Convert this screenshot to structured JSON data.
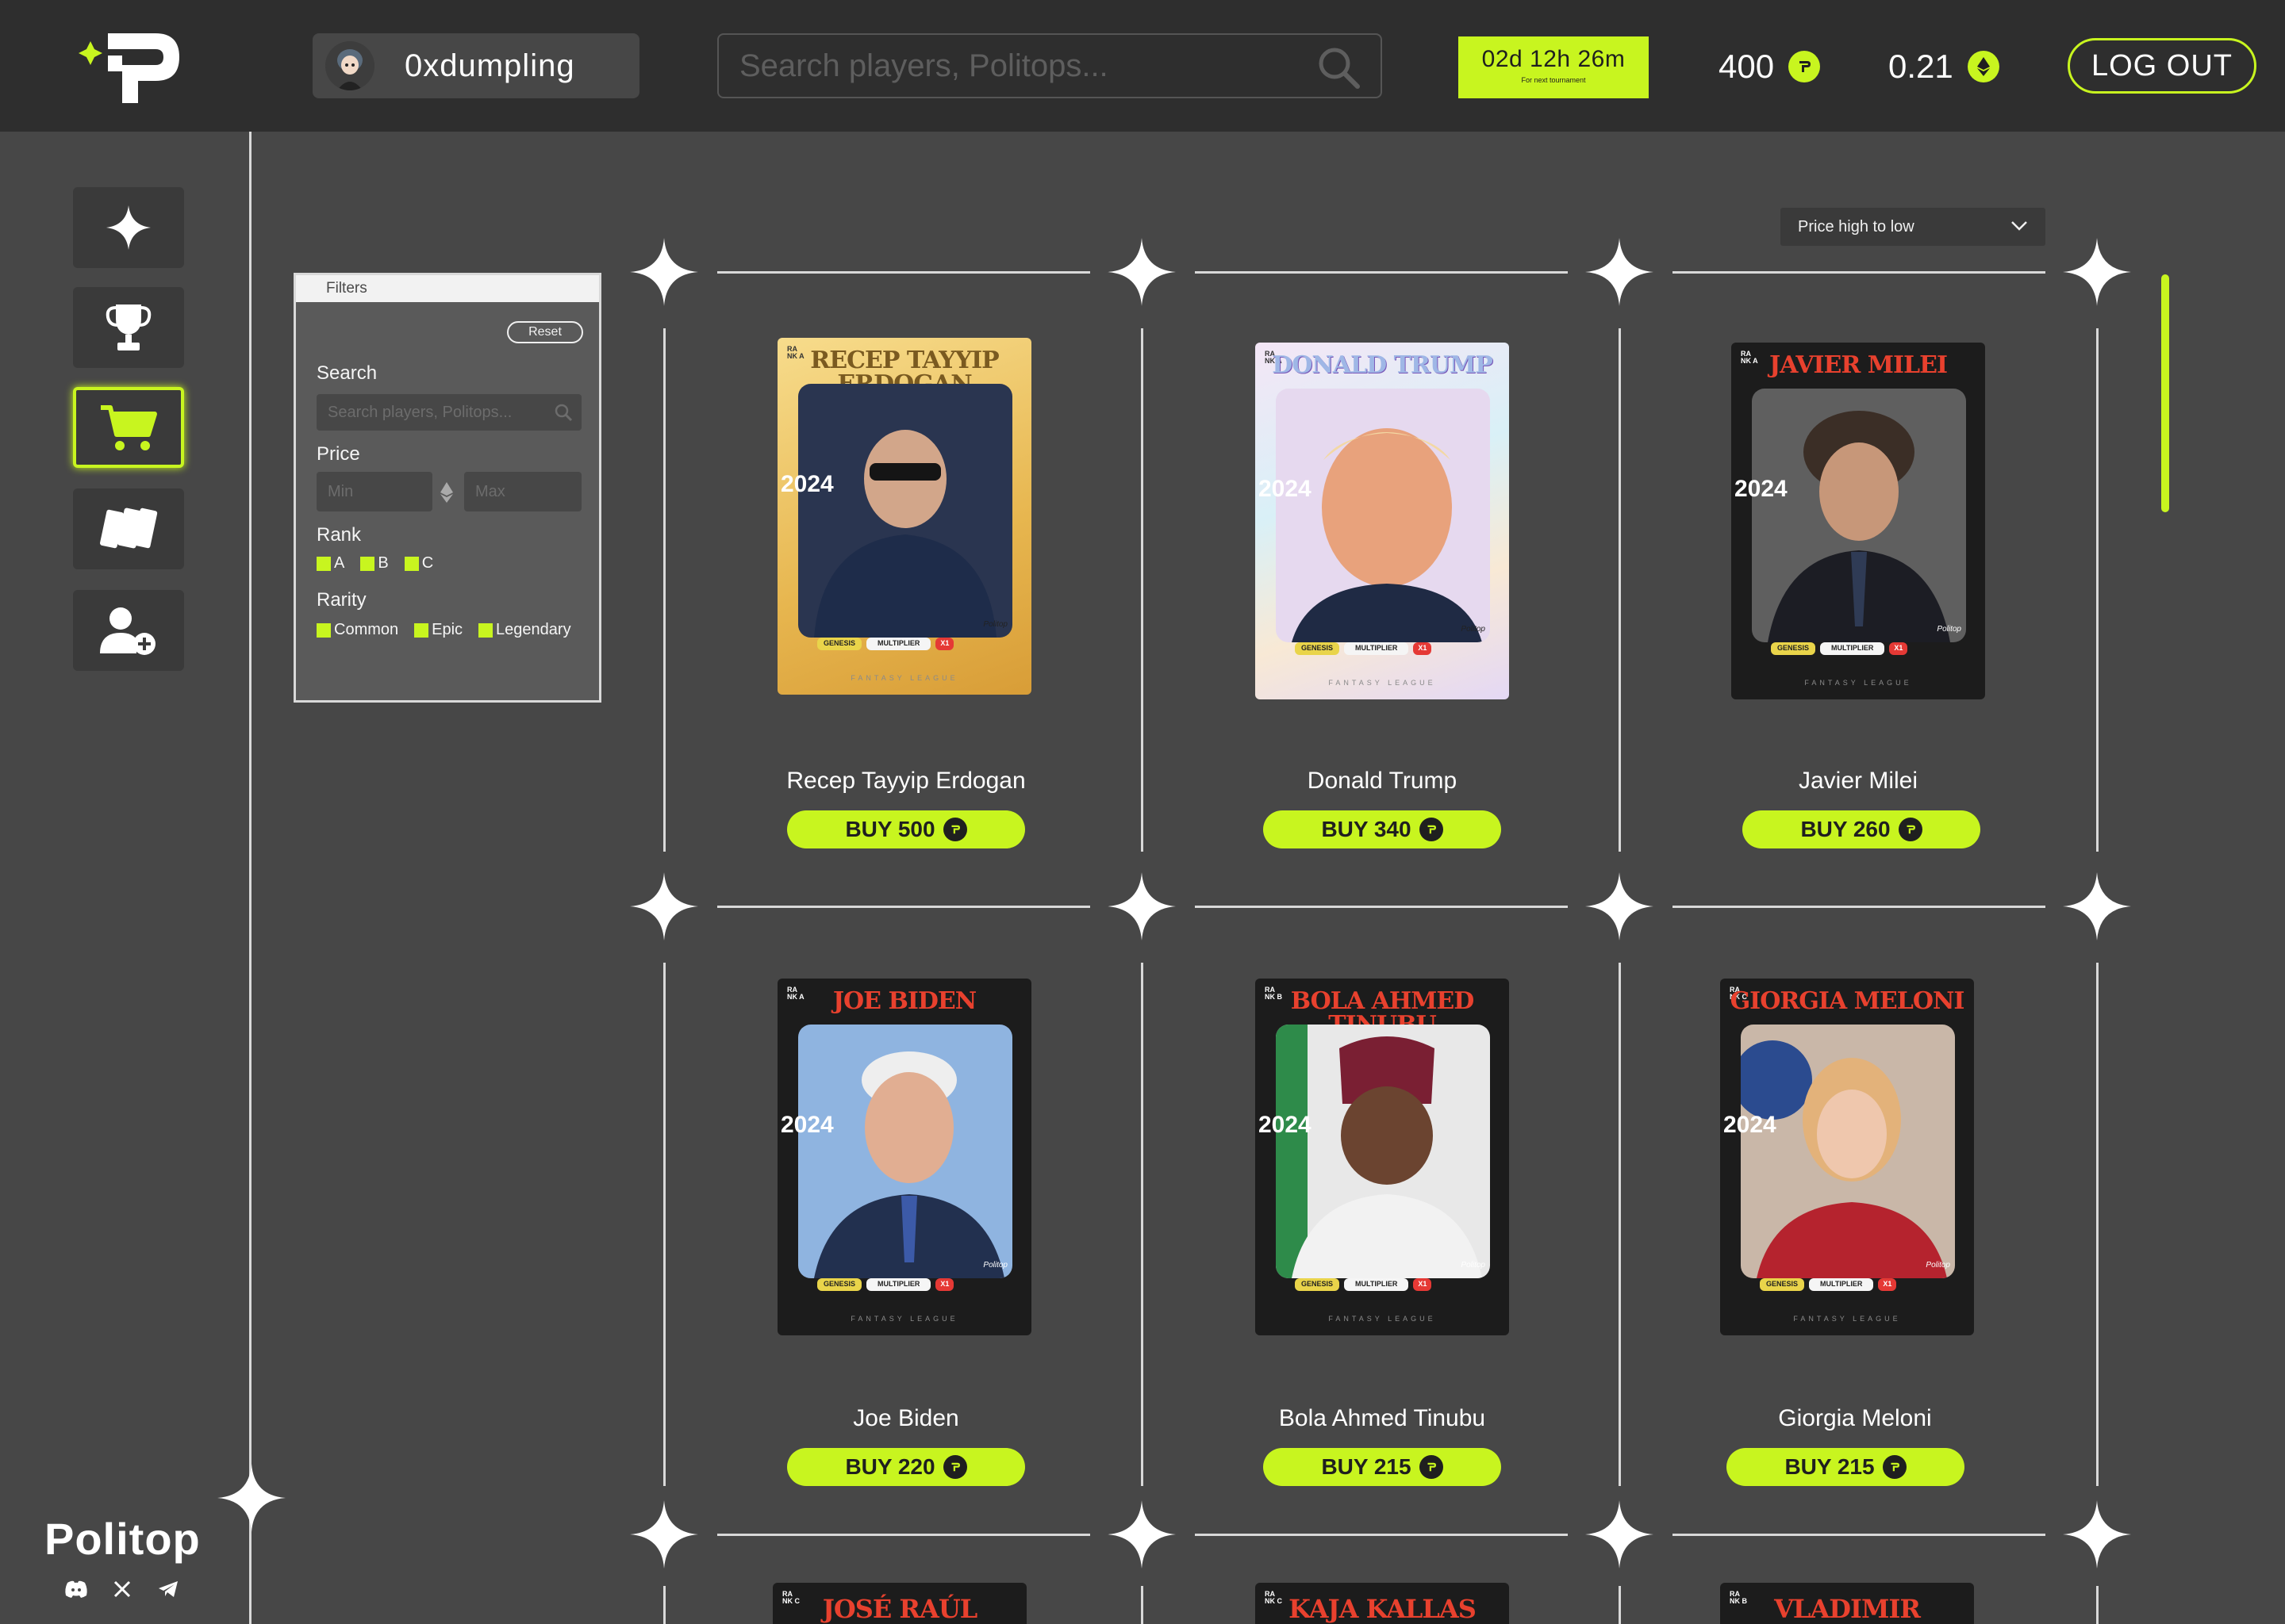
{
  "app": {
    "brand_name": "Politop",
    "accent_color": "#c8f51f",
    "background_color": "#474747"
  },
  "header": {
    "username": "0xdumpling",
    "search_placeholder": "Search players, Politops...",
    "timer": {
      "value": "02d 12h 26m",
      "caption": "For next tournament"
    },
    "points_balance": "400",
    "eth_balance": "0.21",
    "logout_label": "LOG OUT"
  },
  "sidebar": {
    "items": [
      {
        "icon": "sparkle-icon",
        "active": false
      },
      {
        "icon": "trophy-icon",
        "active": false
      },
      {
        "icon": "cart-icon",
        "active": true
      },
      {
        "icon": "cards-icon",
        "active": false
      },
      {
        "icon": "add-user-icon",
        "active": false
      }
    ],
    "social": [
      "discord-icon",
      "x-icon",
      "telegram-icon"
    ]
  },
  "filters": {
    "title": "Filters",
    "reset_label": "Reset",
    "search_label": "Search",
    "search_placeholder": "Search players, Politops...",
    "price_label": "Price",
    "min_placeholder": "Min",
    "max_placeholder": "Max",
    "rank_label": "Rank",
    "ranks": [
      "A",
      "B",
      "C"
    ],
    "rarity_label": "Rarity",
    "rarities": [
      "Common",
      "Epic",
      "Legendary"
    ]
  },
  "sort": {
    "selected": "Price high to low"
  },
  "cards": [
    {
      "name": "Recep Tayyip Erdogan",
      "card_title": "RECEP TAYYIP ERDOGAN",
      "rank_code": "RA NK A",
      "buy_label": "BUY 500",
      "year": "2024",
      "variant": "gold"
    },
    {
      "name": "Donald Trump",
      "card_title": "DONALD TRUMP",
      "rank_code": "RA NK A",
      "buy_label": "BUY 340",
      "year": "2024",
      "variant": "holo"
    },
    {
      "name": "Javier Milei",
      "card_title": "JAVIER MILEI",
      "rank_code": "RA NK A",
      "buy_label": "BUY 260",
      "year": "2024",
      "variant": "dark"
    },
    {
      "name": "Joe Biden",
      "card_title": "JOE BIDEN",
      "rank_code": "RA NK A",
      "buy_label": "BUY 220",
      "year": "2024",
      "variant": "dark"
    },
    {
      "name": "Bola Ahmed Tinubu",
      "card_title": "BOLA AHMED TINUBU",
      "rank_code": "RA NK B",
      "buy_label": "BUY 215",
      "year": "2024",
      "variant": "dark"
    },
    {
      "name": "Giorgia Meloni",
      "card_title": "GIORGIA MELONI",
      "rank_code": "RA NK C",
      "buy_label": "BUY 215",
      "year": "2024",
      "variant": "dark"
    }
  ],
  "card_labels": {
    "genesis": "GENESIS",
    "multiplier": "MULTIPLIER",
    "mult_value": "X1",
    "footer": "FANTASY LEAGUE",
    "signature": "Politop"
  },
  "partial_cards": [
    {
      "card_title": "JOSÉ RAÚL",
      "rank_code": "RA NK C"
    },
    {
      "card_title": "KAJA KALLAS",
      "rank_code": "RA NK C"
    },
    {
      "card_title": "VLADIMIR",
      "rank_code": "RA NK B"
    }
  ]
}
